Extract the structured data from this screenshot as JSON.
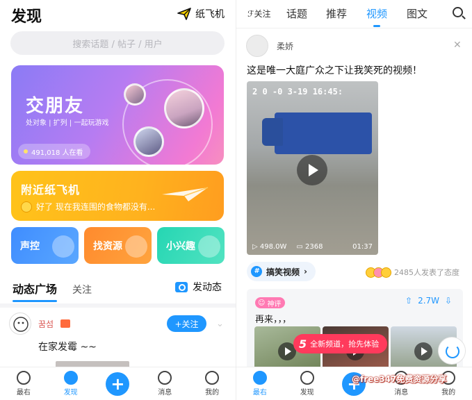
{
  "left": {
    "title": "发现",
    "plane_label": "纸飞机",
    "search_placeholder": "搜索话题 / 帖子 / 用户",
    "friends_card": {
      "title": "交朋友",
      "subtitle": "处对象 | 扩列 | 一起玩游戏",
      "online_count": "491,018 人在看"
    },
    "nearby_card": {
      "title": "附近纸飞机",
      "message": "好了 现在我连围的食物都没有..."
    },
    "tiles": [
      "声控",
      "找资源",
      "小兴趣"
    ],
    "feed_tabs": {
      "active": "动态广场",
      "other": "关注"
    },
    "post_button": "发动态",
    "post": {
      "username": "꿈섬",
      "follow_label": "+关注",
      "text": "在家发霉 ~~"
    },
    "bottom_nav": [
      "最右",
      "发现",
      "消息",
      "我的"
    ]
  },
  "right": {
    "follow_tab": "关注",
    "tabs": [
      "话题",
      "推荐",
      "视频",
      "图文"
    ],
    "active_tab": "视频",
    "post": {
      "username": "柔娇",
      "title": "这是唯一大庭广众之下让我笑死的视频！",
      "video_timestamp": "2 0 -0 3-19  16:45:",
      "views": "498.0W",
      "comments": "2368",
      "duration": "01:37",
      "tag": "搞笑视频",
      "reactions": "2485人发表了态度"
    },
    "comment": {
      "badge": "神评",
      "votes": "2.7W",
      "text": "再来，，，",
      "promo": "全新频道，抢先体验",
      "promo_number": "5"
    },
    "bottom_nav": [
      "最右",
      "发现",
      "消息",
      "我的"
    ],
    "watermark": "@free347免费资源分享"
  },
  "colors": {
    "accent": "#1f97ff",
    "friends_gradient_start": "#8b7bf5",
    "friends_gradient_end": "#f78fbf",
    "nearby": "#ffb21e",
    "promo": "#ff3a5c"
  }
}
